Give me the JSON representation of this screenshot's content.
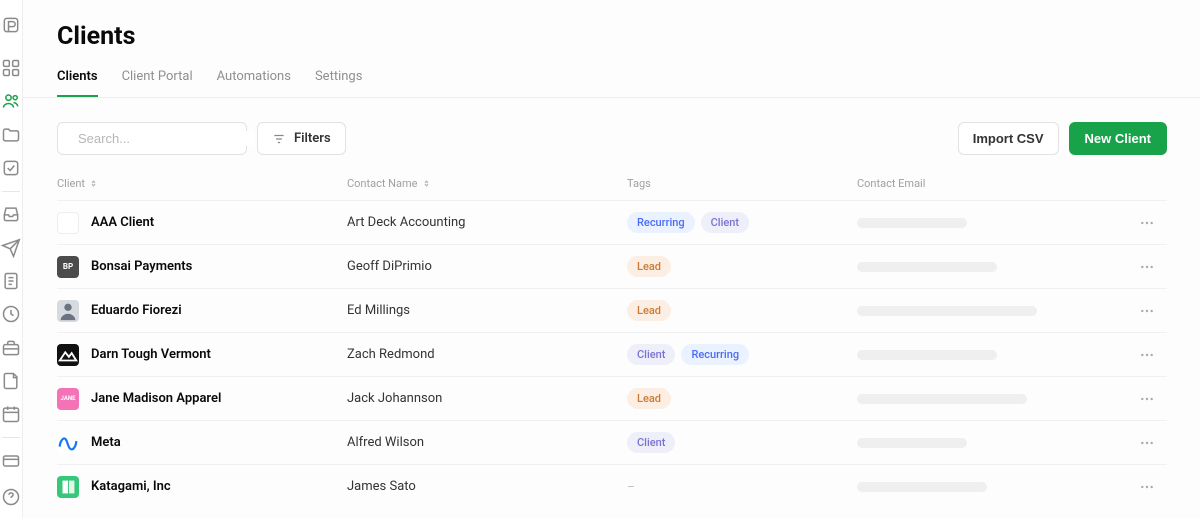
{
  "header": {
    "title": "Clients"
  },
  "tabs": [
    {
      "label": "Clients",
      "active": true
    },
    {
      "label": "Client Portal",
      "active": false
    },
    {
      "label": "Automations",
      "active": false
    },
    {
      "label": "Settings",
      "active": false
    }
  ],
  "toolbar": {
    "search_placeholder": "Search...",
    "filters_label": "Filters",
    "import_label": "Import CSV",
    "new_label": "New Client"
  },
  "columns": {
    "client": "Client",
    "contact_name": "Contact Name",
    "tags": "Tags",
    "contact_email": "Contact Email"
  },
  "rows": [
    {
      "client": "AAA Client",
      "contact": "Art Deck Accounting",
      "tags": [
        "Recurring",
        "Client"
      ],
      "avatar": {
        "type": "blank"
      }
    },
    {
      "client": "Bonsai Payments",
      "contact": "Geoff DiPrimio",
      "tags": [
        "Lead"
      ],
      "avatar": {
        "type": "initials",
        "text": "BP",
        "bg": "#4b4b4b"
      }
    },
    {
      "client": "Eduardo Fiorezi",
      "contact": "Ed Millings",
      "tags": [
        "Lead"
      ],
      "avatar": {
        "type": "person"
      }
    },
    {
      "client": "Darn Tough Vermont",
      "contact": "Zach Redmond",
      "tags": [
        "Client",
        "Recurring"
      ],
      "avatar": {
        "type": "mountain",
        "bg": "#111"
      }
    },
    {
      "client": "Jane Madison Apparel",
      "contact": "Jack Johannson",
      "tags": [
        "Lead"
      ],
      "avatar": {
        "type": "initials",
        "text": "JANE",
        "bg": "#f472b6"
      }
    },
    {
      "client": "Meta",
      "contact": "Alfred Wilson",
      "tags": [
        "Client"
      ],
      "avatar": {
        "type": "meta"
      }
    },
    {
      "client": "Katagami, Inc",
      "contact": "James Sato",
      "tags": [],
      "avatar": {
        "type": "katagami",
        "bg": "#37c77a"
      }
    }
  ],
  "email_skeleton_widths": [
    110,
    140,
    180,
    140,
    170,
    110,
    130
  ],
  "tag_class_map": {
    "Recurring": "tag-recurring",
    "Client": "tag-client",
    "Lead": "tag-lead"
  }
}
